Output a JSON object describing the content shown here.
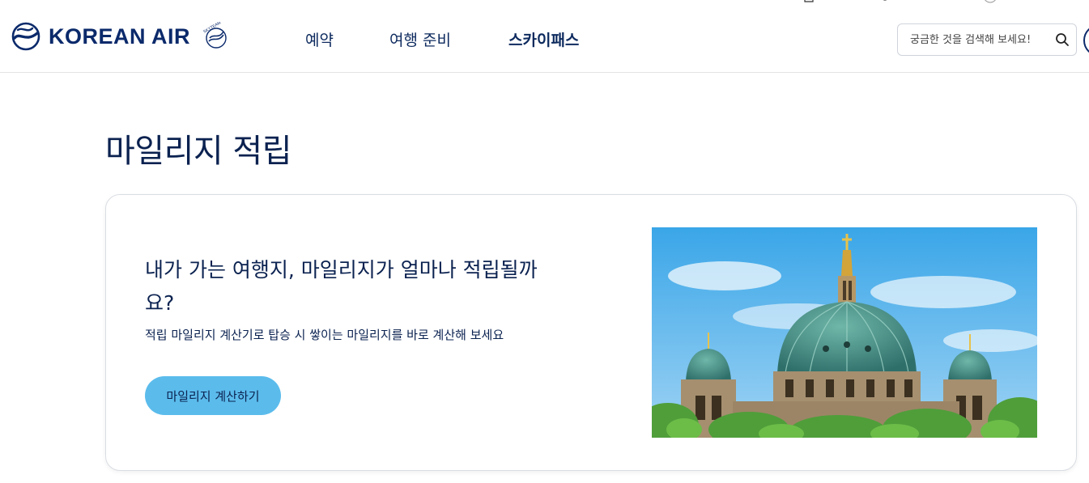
{
  "header": {
    "logo_text": "KOREAN AIR",
    "skyteam_label": "SKYTEAM",
    "nav": [
      {
        "label": "예약",
        "bold": false
      },
      {
        "label": "여행 준비",
        "bold": false
      },
      {
        "label": "스카이패스",
        "bold": true
      }
    ],
    "search": {
      "placeholder": "궁금한 것을 검색해 보세요!"
    }
  },
  "main": {
    "page_title": "마일리지 적립",
    "card": {
      "heading": "내가 가는 여행지, 마일리지가 얼마나 적립될까요?",
      "description": "적립 마일리지 계산기로 탑승 시 쌓이는 마일리지를 바로 계산해 보세요",
      "button_label": "마일리지 계산하기",
      "image_alt": "Berlin Cathedral dome"
    }
  },
  "colors": {
    "brand_navy": "#0b2a6b",
    "button_sky": "#5bbcec"
  },
  "icons": [
    "korean-air-logo",
    "skyteam-logo",
    "search-icon",
    "menu-icon"
  ]
}
